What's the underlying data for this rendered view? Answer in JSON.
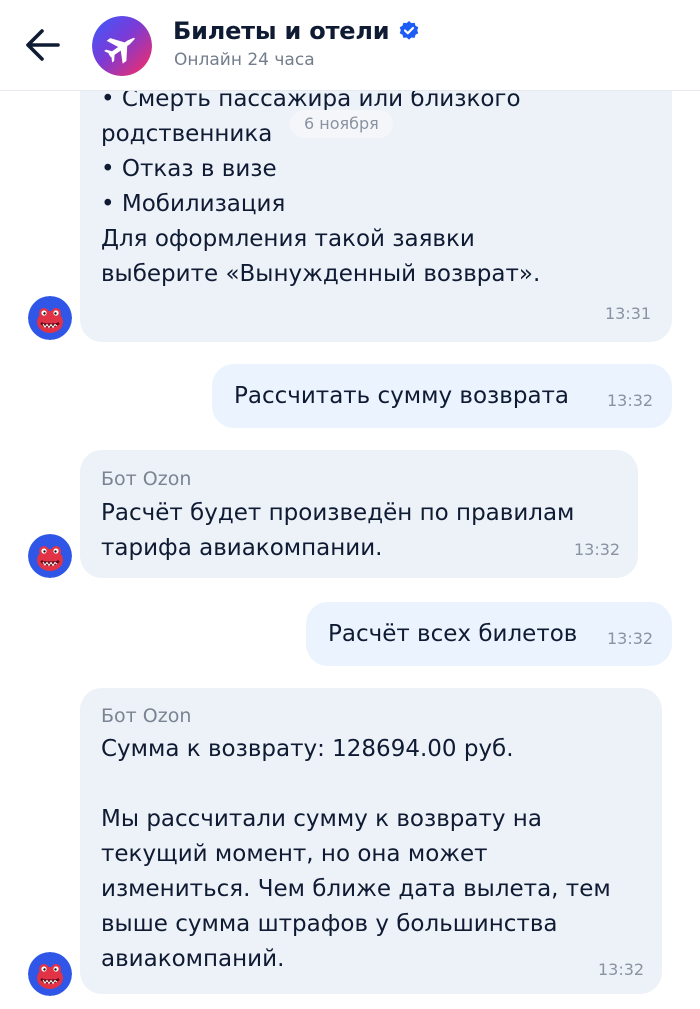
{
  "header": {
    "title": "Билеты и отели",
    "subtitle": "Онлайн 24 часа",
    "verified_icon": "verified-check-icon",
    "avatar_icon": "airplane-icon",
    "brand_gradient": [
      "#3b5bff",
      "#ff2b5e"
    ]
  },
  "date_separator": "6 ноября",
  "messages": [
    {
      "direction": "in",
      "lines": [
        "• Смерть пассажира или близкого",
        "родственника",
        "• Отказ в визе",
        "• Мобилизация",
        "Для оформления такой заявки",
        "выберите «Вынужденный возврат»."
      ],
      "time": "13:31"
    },
    {
      "direction": "out",
      "text": "Рассчитать сумму возврата",
      "time": "13:32"
    },
    {
      "direction": "in",
      "sender": "Бот Ozon",
      "lines": [
        "Расчёт будет произведён по правилам",
        "тарифа авиакомпании."
      ],
      "time": "13:32"
    },
    {
      "direction": "out",
      "text": "Расчёт всех билетов",
      "time": "13:32"
    },
    {
      "direction": "in",
      "sender": "Бот Ozon",
      "lines": [
        "Сумма к возврату: 128694.00 руб.",
        "",
        "Мы рассчитали сумму к возврату на",
        "текущий момент, но она может",
        "измениться. Чем ближе дата вылета, тем",
        "выше сумма штрафов у большинства",
        "авиакомпаний."
      ],
      "time": "13:32"
    }
  ],
  "colors": {
    "incoming_bubble": "#edf1f8",
    "outgoing_bubble": "#eaf3fe",
    "verified_blue": "#1d5cf5",
    "bot_avatar_bg": "#2f56e6",
    "bot_mascot": "#e23246"
  }
}
